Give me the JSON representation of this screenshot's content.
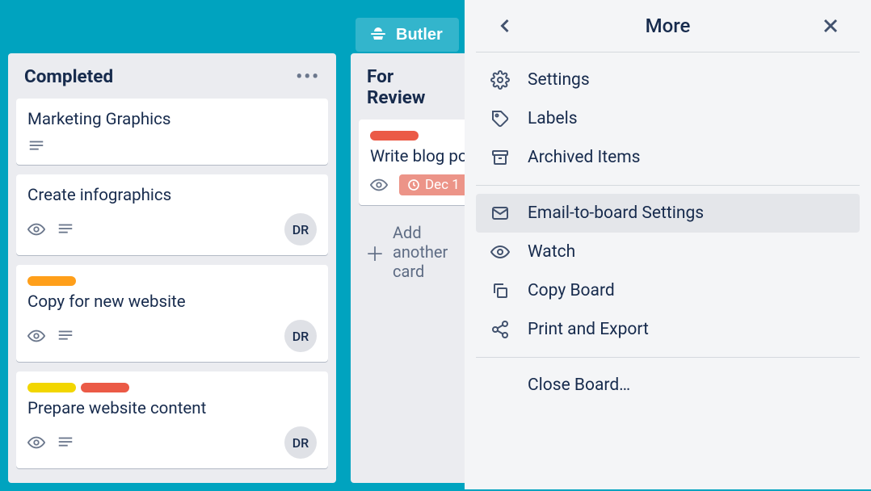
{
  "header": {
    "butler_label": "Butler"
  },
  "lists": [
    {
      "title": "Completed",
      "cards": [
        {
          "title": "Marketing Graphics",
          "labels": [],
          "watch": false,
          "desc": true,
          "member": null,
          "due": null
        },
        {
          "title": "Create infographics",
          "labels": [],
          "watch": true,
          "desc": true,
          "member": "DR",
          "due": null
        },
        {
          "title": "Copy for new website",
          "labels": [
            "orange"
          ],
          "watch": true,
          "desc": true,
          "member": "DR",
          "due": null
        },
        {
          "title": "Prepare website content",
          "labels": [
            "yellow",
            "red"
          ],
          "watch": true,
          "desc": true,
          "member": "DR",
          "due": null
        }
      ]
    },
    {
      "title": "For Review",
      "cards": [
        {
          "title": "Write blog post",
          "labels": [
            "red"
          ],
          "watch": true,
          "desc": false,
          "member": null,
          "due": "Dec 1"
        }
      ],
      "add_label": "Add another card"
    }
  ],
  "panel": {
    "title": "More",
    "sections": [
      [
        "Settings",
        "Labels",
        "Archived Items"
      ],
      [
        "Email-to-board Settings",
        "Watch",
        "Copy Board",
        "Print and Export"
      ],
      [
        "Close Board…"
      ]
    ],
    "highlighted": "Email-to-board Settings"
  }
}
